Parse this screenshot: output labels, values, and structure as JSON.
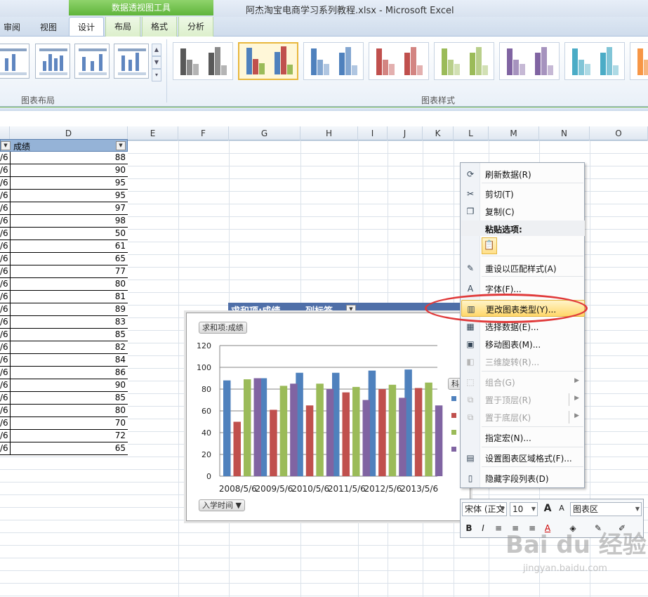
{
  "window": {
    "title": "阿杰淘宝电商学习系列教程.xlsx  -  Microsoft Excel",
    "context_group": "数据透视图工具"
  },
  "tabs": [
    {
      "label": "审阅"
    },
    {
      "label": "视图"
    },
    {
      "label": "设计",
      "active": true
    },
    {
      "label": "布局"
    },
    {
      "label": "格式"
    },
    {
      "label": "分析"
    }
  ],
  "ribbon": {
    "groups": {
      "layout": "图表布局",
      "styles": "图表样式"
    },
    "style_colors": [
      "#595959",
      "#4f81bd",
      "#4f81bd",
      "#c0504d",
      "#9bbb59",
      "#8064a2",
      "#4bacc6",
      "#f79646"
    ]
  },
  "sheet": {
    "columns": [
      "D",
      "E",
      "F",
      "G",
      "H",
      "I",
      "J",
      "K",
      "L",
      "M",
      "N",
      "O"
    ],
    "data_header": "成绩",
    "row_stub": "/6",
    "values": [
      88,
      90,
      95,
      95,
      97,
      98,
      50,
      61,
      65,
      77,
      80,
      81,
      89,
      83,
      85,
      82,
      84,
      86,
      90,
      85,
      80,
      70,
      72,
      65
    ],
    "pivot_band": {
      "value_label": "求和项:成绩",
      "column_label": "列标签"
    }
  },
  "chart": {
    "field_value": "求和项:成绩",
    "field_axis": "入学时间",
    "legend_title": "科"
  },
  "chart_data": {
    "type": "bar",
    "categories": [
      "2008/5/6",
      "2009/5/6",
      "2010/5/6",
      "2011/5/6",
      "2012/5/6",
      "2013/5/6"
    ],
    "series": [
      {
        "values": [
          88,
          90,
          95,
          95,
          97,
          98
        ],
        "color": "#4f81bd"
      },
      {
        "values": [
          50,
          61,
          65,
          77,
          80,
          81
        ],
        "color": "#c0504d"
      },
      {
        "values": [
          89,
          83,
          85,
          82,
          84,
          86
        ],
        "color": "#9bbb59"
      },
      {
        "values": [
          90,
          85,
          80,
          70,
          72,
          65
        ],
        "color": "#8064a2"
      }
    ],
    "ylim": [
      0,
      120
    ],
    "yticks": [
      0,
      20,
      40,
      60,
      80,
      100,
      120
    ],
    "grid": true,
    "title": "",
    "xlabel": "",
    "ylabel": ""
  },
  "context_menu": {
    "items": [
      {
        "label": "刷新数据(R)",
        "icon": "refresh-icon"
      },
      {
        "label": "剪切(T)",
        "icon": "scissors-icon"
      },
      {
        "label": "复制(C)",
        "icon": "copy-icon"
      },
      {
        "label": "粘贴选项:",
        "icon": "paste-icon"
      },
      {
        "label": "重设以匹配样式(A)",
        "icon": "reset-style-icon"
      },
      {
        "label": "字体(F)...",
        "icon": "font-icon"
      },
      {
        "label": "更改图表类型(Y)...",
        "icon": "chart-type-icon",
        "highlighted": true
      },
      {
        "label": "选择数据(E)...",
        "icon": "select-data-icon"
      },
      {
        "label": "移动图表(M)...",
        "icon": "move-chart-icon"
      },
      {
        "label": "三维旋转(R)...",
        "icon": "rotate-3d-icon",
        "disabled": true
      },
      {
        "label": "组合(G)",
        "icon": "group-icon",
        "disabled": true
      },
      {
        "label": "置于顶层(R)",
        "icon": "bring-front-icon",
        "disabled": true
      },
      {
        "label": "置于底层(K)",
        "icon": "send-back-icon",
        "disabled": true
      },
      {
        "label": "指定宏(N)...",
        "icon": "macro-icon"
      },
      {
        "label": "设置图表区域格式(F)...",
        "icon": "format-area-icon"
      },
      {
        "label": "隐藏字段列表(D)",
        "icon": "field-list-icon"
      }
    ]
  },
  "mini_toolbar": {
    "font": "宋体 (正文",
    "size": "10",
    "element": "图表区",
    "bold": "B",
    "italic": "I",
    "grow": "A",
    "shrink": "A",
    "font_color": "A"
  },
  "watermark": {
    "logo": "Bai du 经验",
    "url": "jingyan.baidu.com"
  }
}
